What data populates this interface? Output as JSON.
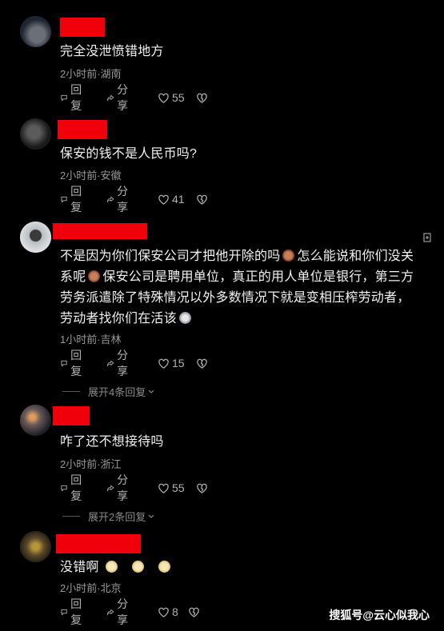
{
  "comments": [
    {
      "text": "完全没泄愤错地方",
      "meta": "2小时前·湖南",
      "reply_label": "回复",
      "share_label": "分享",
      "likes": "55"
    },
    {
      "text": "保安的钱不是人民币吗?",
      "meta": "2小时前·安徽",
      "reply_label": "回复",
      "share_label": "分享",
      "likes": "41"
    },
    {
      "text_1": "不是因为你们保安公司才把他开除的吗",
      "text_2": "怎么能说和你们没关",
      "text_3": "系呢",
      "text_4": "保安公司是聘用单位，真正的用人单位是银行，第三方",
      "text_5": "劳务派遣除了特殊情况以外多数情况下就是变相压榨劳动者，",
      "text_6": "劳动者找你们在活该",
      "meta": "1小时前·吉林",
      "reply_label": "回复",
      "share_label": "分享",
      "likes": "15",
      "expand_label": "展开4条回复"
    },
    {
      "text": "咋了还不想接待吗",
      "meta": "2小时前·浙江",
      "reply_label": "回复",
      "share_label": "分享",
      "likes": "55",
      "expand_label": "展开2条回复"
    },
    {
      "text": "没错啊",
      "meta": "2小时前·北京",
      "reply_label": "回复",
      "share_label": "分享",
      "likes": "8"
    }
  ],
  "watermark": "搜狐号@云心似我心",
  "colors": {
    "background": "#000000",
    "redaction": "#f0000a",
    "meta": "#9a9a9a"
  }
}
